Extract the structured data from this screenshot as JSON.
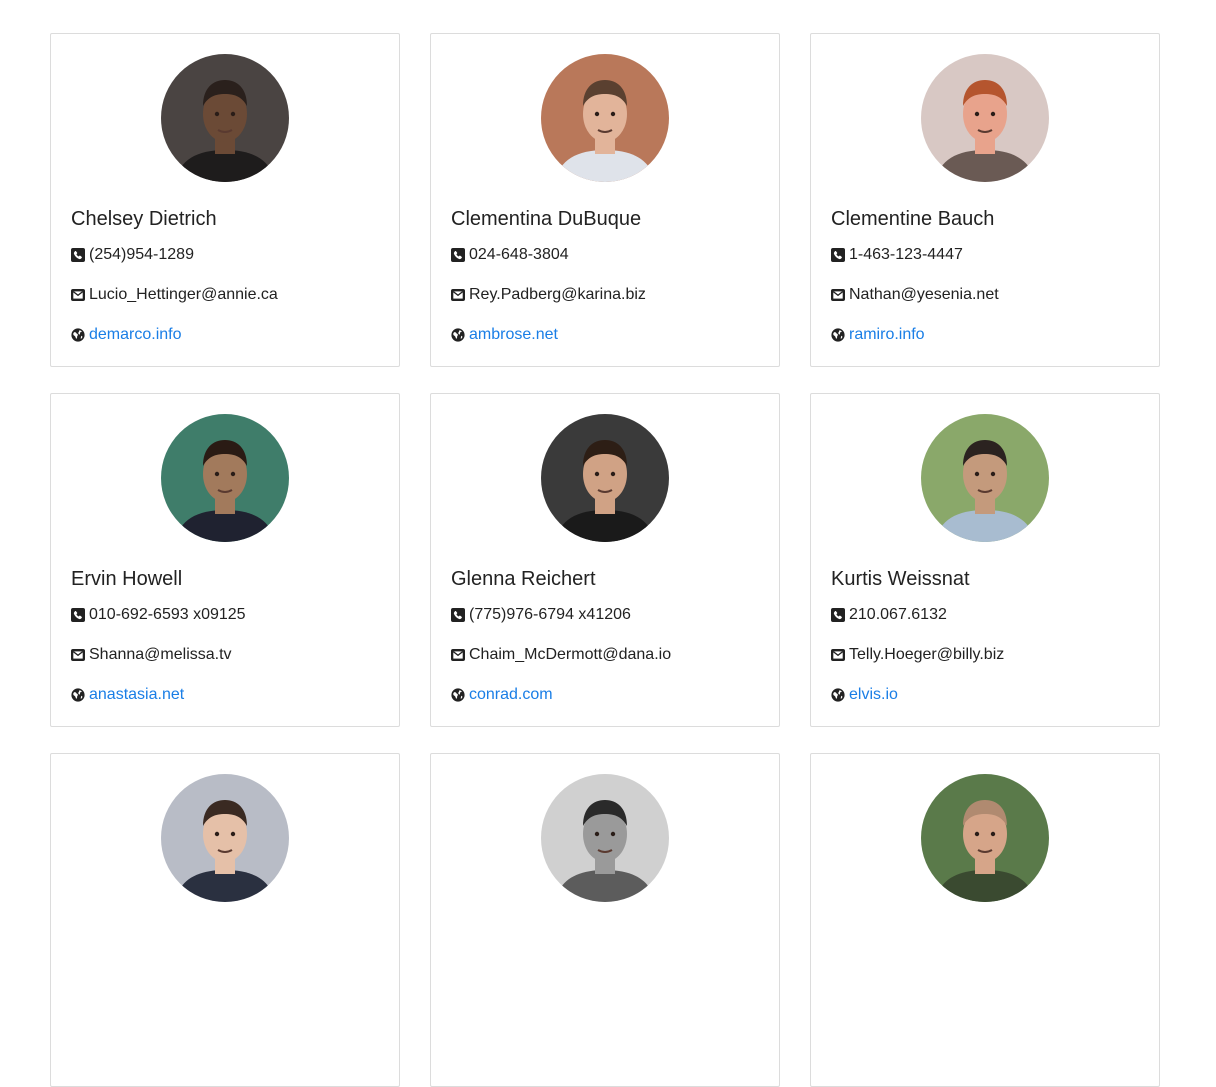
{
  "contacts": [
    {
      "name": "Chelsey Dietrich",
      "phone": "(254)954-1289",
      "email": "Lucio_Hettinger@annie.ca",
      "website": "demarco.info",
      "avatar": {
        "bg": "#4a4442",
        "skin": "#6b4a36",
        "hair": "#2a201c",
        "shirt": "#1e1c1c"
      }
    },
    {
      "name": "Clementina DuBuque",
      "phone": "024-648-3804",
      "email": "Rey.Padberg@karina.biz",
      "website": "ambrose.net",
      "avatar": {
        "bg": "#b9785a",
        "skin": "#e2b49a",
        "hair": "#5a4030",
        "shirt": "#dfe3ea"
      }
    },
    {
      "name": "Clementine Bauch",
      "phone": "1-463-123-4447",
      "email": "Nathan@yesenia.net",
      "website": "ramiro.info",
      "avatar": {
        "bg": "#d8c8c4",
        "skin": "#e8a38c",
        "hair": "#b5552e",
        "shirt": "#6a5a54"
      }
    },
    {
      "name": "Ervin Howell",
      "phone": "010-692-6593 x09125",
      "email": "Shanna@melissa.tv",
      "website": "anastasia.net",
      "avatar": {
        "bg": "#3f7d6a",
        "skin": "#a27a5c",
        "hair": "#2a1b14",
        "shirt": "#1f2230"
      }
    },
    {
      "name": "Glenna Reichert",
      "phone": "(775)976-6794 x41206",
      "email": "Chaim_McDermott@dana.io",
      "website": "conrad.com",
      "avatar": {
        "bg": "#3a3a3a",
        "skin": "#d0a285",
        "hair": "#2d1e15",
        "shirt": "#1a1a1a"
      }
    },
    {
      "name": "Kurtis Weissnat",
      "phone": "210.067.6132",
      "email": "Telly.Hoeger@billy.biz",
      "website": "elvis.io",
      "avatar": {
        "bg": "#8aa86a",
        "skin": "#c49a7c",
        "hair": "#2b2320",
        "shirt": "#a8bcd0"
      }
    },
    {
      "name": "",
      "phone": "",
      "email": "",
      "website": "",
      "avatar": {
        "bg": "#b8bcc6",
        "skin": "#e5c0a8",
        "hair": "#3a2a22",
        "shirt": "#2a3040"
      }
    },
    {
      "name": "",
      "phone": "",
      "email": "",
      "website": "",
      "avatar": {
        "bg": "#d0d0d0",
        "skin": "#9a9a9a",
        "hair": "#2a2a2a",
        "shirt": "#5c5c5c"
      }
    },
    {
      "name": "",
      "phone": "",
      "email": "",
      "website": "",
      "avatar": {
        "bg": "#5a7a4a",
        "skin": "#d6a589",
        "hair": "#b08a70",
        "shirt": "#3a4a30"
      }
    }
  ],
  "icons": {
    "phone": "phone-icon",
    "email": "envelope-icon",
    "website": "globe-icon"
  },
  "colors": {
    "link": "#1a7ee6",
    "border": "#dcdcdc",
    "text": "#222222"
  }
}
